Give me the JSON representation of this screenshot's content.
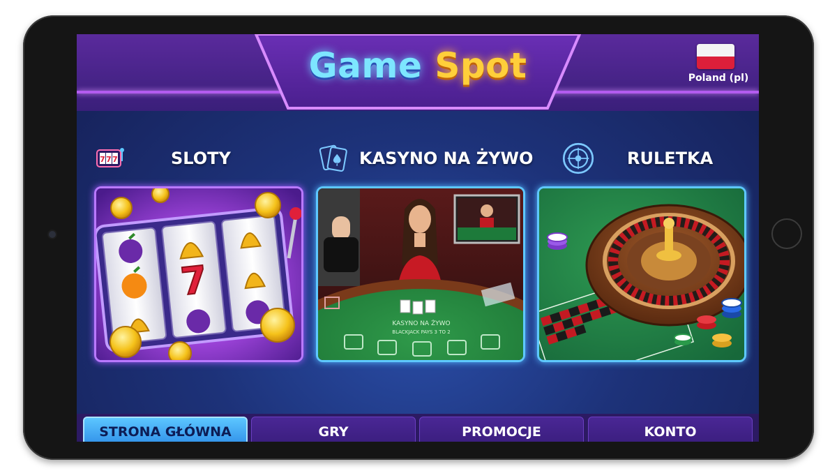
{
  "app": {
    "logo_word1": "Game",
    "logo_word2": "Spot"
  },
  "locale": {
    "region_label": "Poland (pl)",
    "flag": "poland-flag"
  },
  "categories": [
    {
      "label": "SLOTY",
      "icon": "slot-777-icon"
    },
    {
      "label": "KASYNO NA ŻYWO",
      "icon": "playing-cards-icon"
    },
    {
      "label": "RULETKA",
      "icon": "roulette-wheel-icon"
    }
  ],
  "cards": {
    "live_table_text_1": "KASYNO NA ŻYWO",
    "live_table_text_2": "BLACKJACK PAYS 3 TO 2",
    "slot_reel_symbols": [
      "plum",
      "orange",
      "bell",
      "7",
      "bell",
      "plum",
      "bell",
      "bell",
      "plum"
    ]
  },
  "bottom_nav": [
    {
      "label": "STRONA GŁÓWNA",
      "active": true
    },
    {
      "label": "GRY",
      "active": false
    },
    {
      "label": "PROMOCJE",
      "active": false
    },
    {
      "label": "KONTO",
      "active": false
    }
  ],
  "colors": {
    "accent_purple": "#b45cf0",
    "active_tab": "#3aa2f0",
    "logo_cyan": "#7de6ff",
    "logo_gold": "#ffcf3a"
  }
}
